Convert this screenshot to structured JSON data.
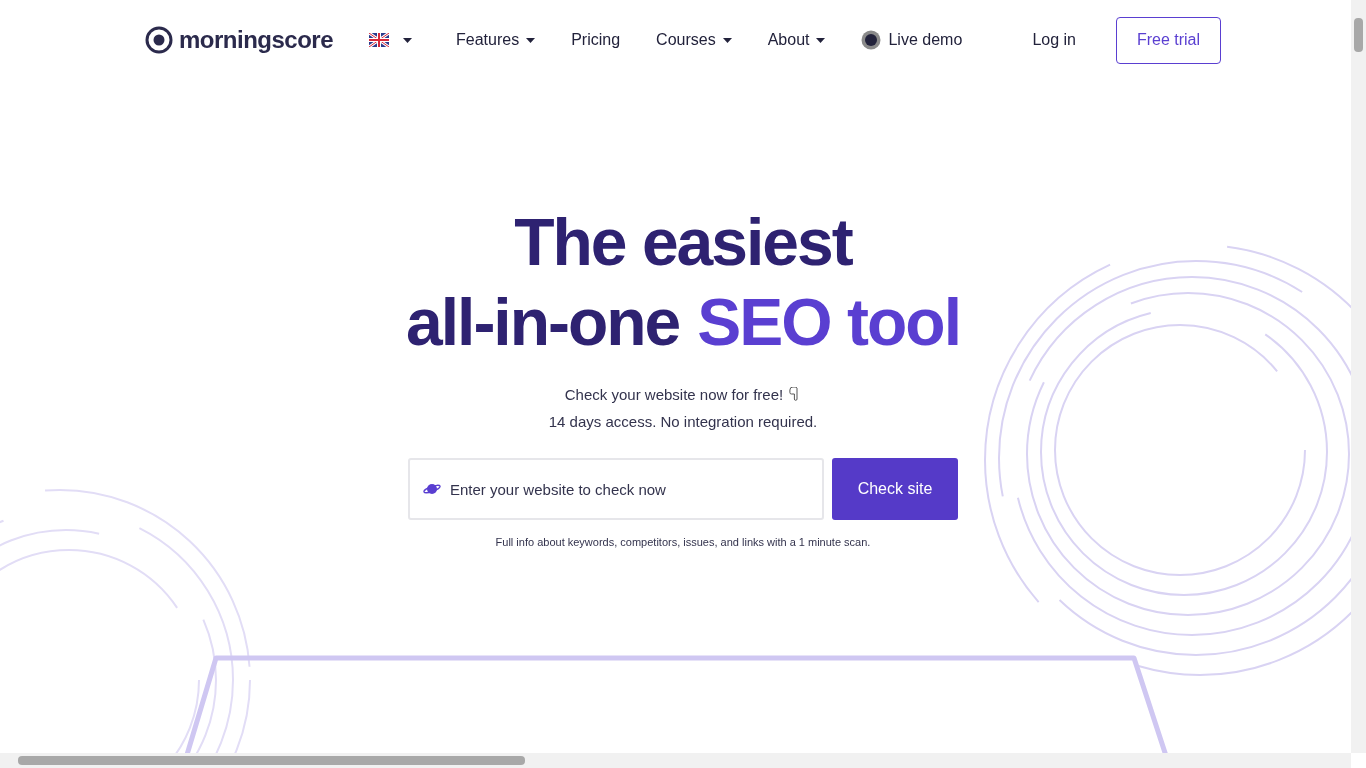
{
  "header": {
    "logo": "morningscore",
    "language_dropdown": true,
    "nav": [
      {
        "label": "Features",
        "dropdown": true,
        "kind": "menu"
      },
      {
        "label": "Pricing",
        "dropdown": false,
        "kind": "menu"
      },
      {
        "label": "Courses",
        "dropdown": true,
        "kind": "menu"
      },
      {
        "label": "About",
        "dropdown": true,
        "kind": "menu"
      },
      {
        "label": "Live demo",
        "dropdown": false,
        "kind": "live"
      }
    ],
    "login": "Log in",
    "cta": "Free trial"
  },
  "hero": {
    "title_line1": "The easiest",
    "title_line2": "all-in-one",
    "title_highlight": "SEO tool",
    "subtitle": "Check your website now for free!",
    "subtitle2": "14 days access. No integration required.",
    "search": {
      "placeholder": "Enter your website to check now",
      "button": "Check site"
    },
    "note": "Full info about keywords, competitors, issues, and links with a 1 minute scan."
  }
}
